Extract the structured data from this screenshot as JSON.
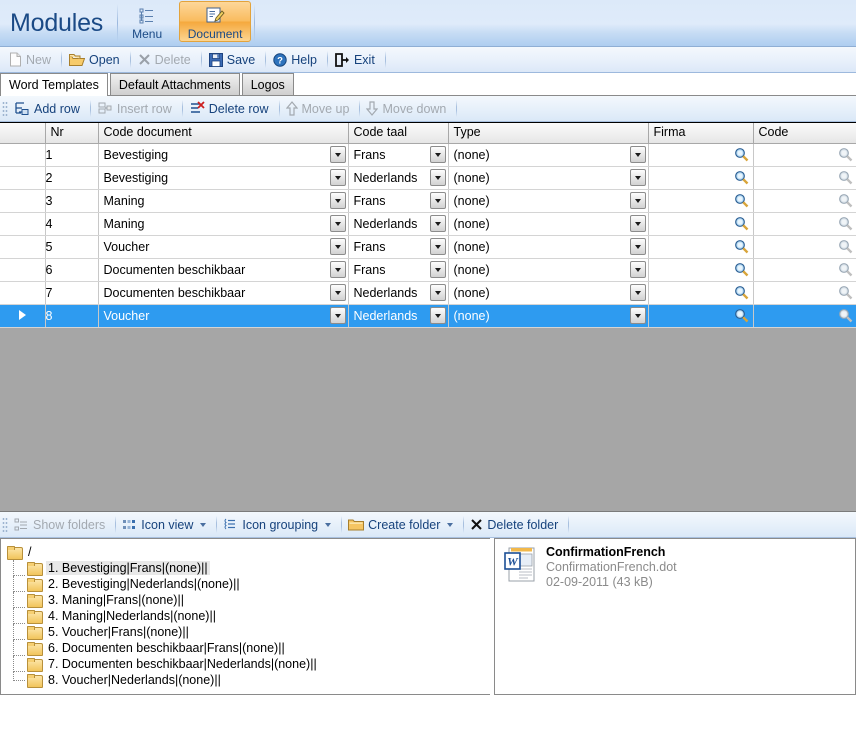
{
  "app": {
    "title": "Modules"
  },
  "ribbon": {
    "buttons": [
      {
        "label": "Menu",
        "icon": "list-icon",
        "active": false
      },
      {
        "label": "Document",
        "icon": "document-edit-icon",
        "active": true
      }
    ]
  },
  "menubar": {
    "items": [
      {
        "label": "New",
        "icon": "page-icon",
        "enabled": false
      },
      {
        "label": "Open",
        "icon": "folder-open-icon",
        "enabled": true
      },
      {
        "label": "Delete",
        "icon": "x-icon",
        "enabled": false
      },
      {
        "label": "Save",
        "icon": "floppy-icon",
        "enabled": true
      },
      {
        "label": "Help",
        "icon": "question-circle-icon",
        "enabled": true
      },
      {
        "label": "Exit",
        "icon": "exit-icon",
        "enabled": true
      }
    ]
  },
  "tabs": [
    {
      "label": "Word Templates",
      "selected": true
    },
    {
      "label": "Default Attachments",
      "selected": false
    },
    {
      "label": "Logos",
      "selected": false
    }
  ],
  "grid_toolbar": {
    "items": [
      {
        "label": "Add row",
        "icon": "add-row-icon",
        "enabled": true
      },
      {
        "label": "Insert row",
        "icon": "insert-row-icon",
        "enabled": false
      },
      {
        "label": "Delete row",
        "icon": "delete-row-icon",
        "enabled": true
      },
      {
        "label": "Move up",
        "icon": "arrow-up-icon",
        "enabled": false
      },
      {
        "label": "Move down",
        "icon": "arrow-down-icon",
        "enabled": false
      }
    ]
  },
  "grid": {
    "columns": [
      "",
      "Nr",
      "Code document",
      "Code taal",
      "Type",
      "Firma",
      "Code"
    ],
    "rows": [
      {
        "nr": "1",
        "code_document": "Bevestiging",
        "code_taal": "Frans",
        "type": "(none)",
        "firma": "",
        "code": "",
        "selected": false
      },
      {
        "nr": "2",
        "code_document": "Bevestiging",
        "code_taal": "Nederlands",
        "type": "(none)",
        "firma": "",
        "code": "",
        "selected": false
      },
      {
        "nr": "3",
        "code_document": "Maning",
        "code_taal": "Frans",
        "type": "(none)",
        "firma": "",
        "code": "",
        "selected": false
      },
      {
        "nr": "4",
        "code_document": "Maning",
        "code_taal": "Nederlands",
        "type": "(none)",
        "firma": "",
        "code": "",
        "selected": false
      },
      {
        "nr": "5",
        "code_document": "Voucher",
        "code_taal": "Frans",
        "type": "(none)",
        "firma": "",
        "code": "",
        "selected": false
      },
      {
        "nr": "6",
        "code_document": "Documenten beschikbaar",
        "code_taal": "Frans",
        "type": "(none)",
        "firma": "",
        "code": "",
        "selected": false
      },
      {
        "nr": "7",
        "code_document": "Documenten beschikbaar",
        "code_taal": "Nederlands",
        "type": "(none)",
        "firma": "",
        "code": "",
        "selected": false
      },
      {
        "nr": "8",
        "code_document": "Voucher",
        "code_taal": "Nederlands",
        "type": "(none)",
        "firma": "",
        "code": "",
        "selected": true
      }
    ]
  },
  "folder_toolbar": {
    "items": [
      {
        "label": "Show folders",
        "icon": "tree-icon",
        "enabled": false,
        "caret": false
      },
      {
        "label": "Icon view",
        "icon": "icon-view-icon",
        "enabled": true,
        "caret": true
      },
      {
        "label": "Icon grouping",
        "icon": "icon-grouping-icon",
        "enabled": true,
        "caret": true
      },
      {
        "label": "Create folder",
        "icon": "folder-icon",
        "enabled": true,
        "caret": true
      },
      {
        "label": "Delete folder",
        "icon": "x-icon",
        "enabled": true,
        "caret": false
      }
    ]
  },
  "tree": {
    "root": {
      "label": "/",
      "icon": "folder-icon"
    },
    "nodes": [
      {
        "label": "1. Bevestiging|Frans|(none)||",
        "icon": "folder-icon",
        "selected": true
      },
      {
        "label": "2. Bevestiging|Nederlands|(none)||",
        "icon": "folder-icon",
        "selected": false
      },
      {
        "label": "3. Maning|Frans|(none)||",
        "icon": "folder-icon",
        "selected": false
      },
      {
        "label": "4. Maning|Nederlands|(none)||",
        "icon": "folder-icon",
        "selected": false
      },
      {
        "label": "5. Voucher|Frans|(none)||",
        "icon": "folder-icon",
        "selected": false
      },
      {
        "label": "6. Documenten beschikbaar|Frans|(none)||",
        "icon": "folder-icon",
        "selected": false
      },
      {
        "label": "7. Documenten beschikbaar|Nederlands|(none)||",
        "icon": "folder-icon",
        "selected": false
      },
      {
        "label": "8. Voucher|Nederlands|(none)||",
        "icon": "folder-icon",
        "selected": false
      }
    ]
  },
  "file_panel": {
    "files": [
      {
        "name": "ConfirmationFrench",
        "filename": "ConfirmationFrench.dot",
        "meta": "02-09-2011 (43 kB)",
        "icon": "word-document-icon"
      }
    ]
  },
  "colors": {
    "accent_blue": "#16427c",
    "selection_blue": "#2e9bf0",
    "ribbon_active": "#f5a93e",
    "disabled_gray": "#a3a9b0",
    "grid_empty": "#a6a6a6"
  }
}
